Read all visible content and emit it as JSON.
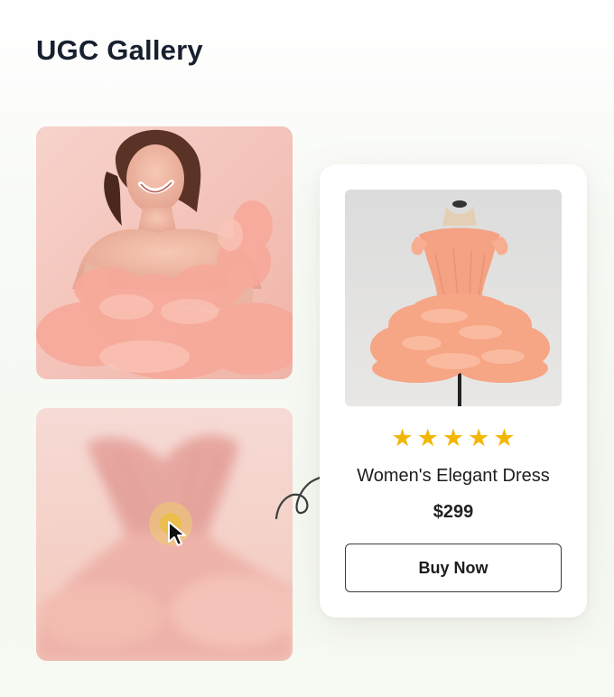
{
  "header": {
    "title": "UGC Gallery"
  },
  "gallery": {
    "images": [
      {
        "icon": "model-photo-icon"
      },
      {
        "icon": "dress-closeup-photo-icon"
      }
    ]
  },
  "product_card": {
    "rating": {
      "stars": 5,
      "max": 5,
      "star_glyph": "★",
      "color": "#f2b705"
    },
    "name": "Women's Elegant Dress",
    "price": "$299",
    "buy_label": "Buy Now"
  },
  "colors": {
    "accent_pink": "#f3b8a8",
    "star": "#f2b705",
    "title": "#17202e"
  }
}
